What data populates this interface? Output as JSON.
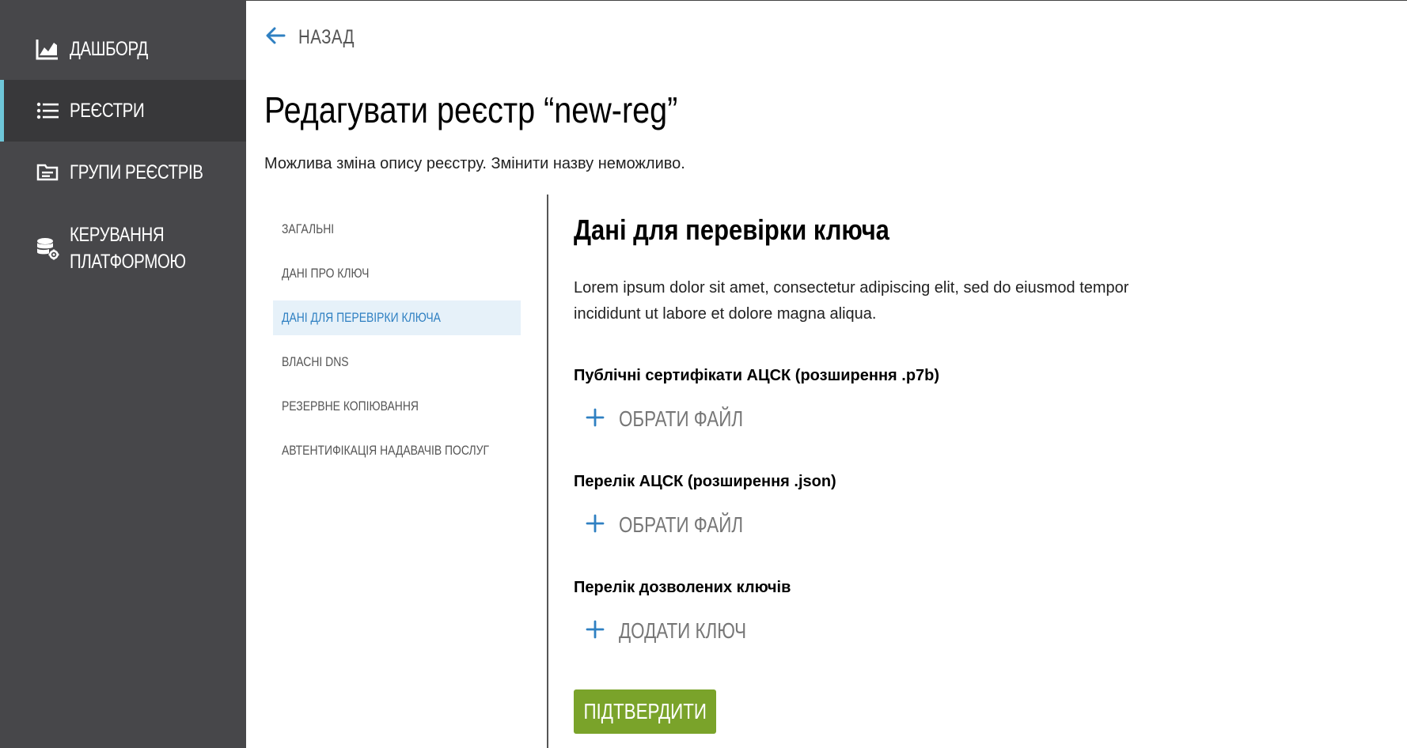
{
  "sidebar": {
    "items": [
      {
        "label": "ДАШБОРД",
        "icon": "chart-icon",
        "active": false
      },
      {
        "label": "РЕЄСТРИ",
        "icon": "list-icon",
        "active": true
      },
      {
        "label": "ГРУПИ РЕЄСТРІВ",
        "icon": "folder-icon",
        "active": false
      },
      {
        "label_line1": "КЕРУВАННЯ",
        "label_line2": "ПЛАТФОРМОЮ",
        "icon": "database-gear-icon",
        "active": false
      }
    ]
  },
  "header": {
    "back_label": "НАЗАД",
    "title": "Редагувати реєстр “new-reg”",
    "subtitle": "Можлива зміна опису реєстру. Змінити назву неможливо."
  },
  "subnav": {
    "items": [
      {
        "label": "ЗАГАЛЬНІ",
        "active": false
      },
      {
        "label": "ДАНІ ПРО КЛЮЧ",
        "active": false
      },
      {
        "label": "ДАНІ ДЛЯ ПЕРЕВІРКИ КЛЮЧА",
        "active": true
      },
      {
        "label": "ВЛАСНІ DNS",
        "active": false
      },
      {
        "label": "РЕЗЕРВНЕ КОПІЮВАННЯ",
        "active": false
      },
      {
        "label": "АВТЕНТИФІКАЦІЯ НАДАВАЧІВ ПОСЛУГ",
        "active": false
      }
    ]
  },
  "section": {
    "title": "Дані для перевірки ключа",
    "description": "Lorem ipsum dolor sit amet, consectetur adipiscing elit, sed do eiusmod tempor incididunt ut labore et dolore magna aliqua.",
    "fields": [
      {
        "label": "Публічні сертифікати АЦСК (розширення .p7b)",
        "action": "ОБРАТИ ФАЙЛ"
      },
      {
        "label": "Перелік АЦСК (розширення .json)",
        "action": "ОБРАТИ ФАЙЛ"
      },
      {
        "label": "Перелік дозволених ключів",
        "action": "ДОДАТИ КЛЮЧ"
      }
    ],
    "confirm_label": "ПІДТВЕРДИТИ"
  },
  "colors": {
    "sidebar_bg": "#47474a",
    "sidebar_active_bg": "#38383a",
    "sidebar_active_accent": "#6ec6d8",
    "link_blue": "#2f80c2",
    "subnav_active_bg": "#e6f1f9",
    "confirm_green": "#7aa32a"
  }
}
